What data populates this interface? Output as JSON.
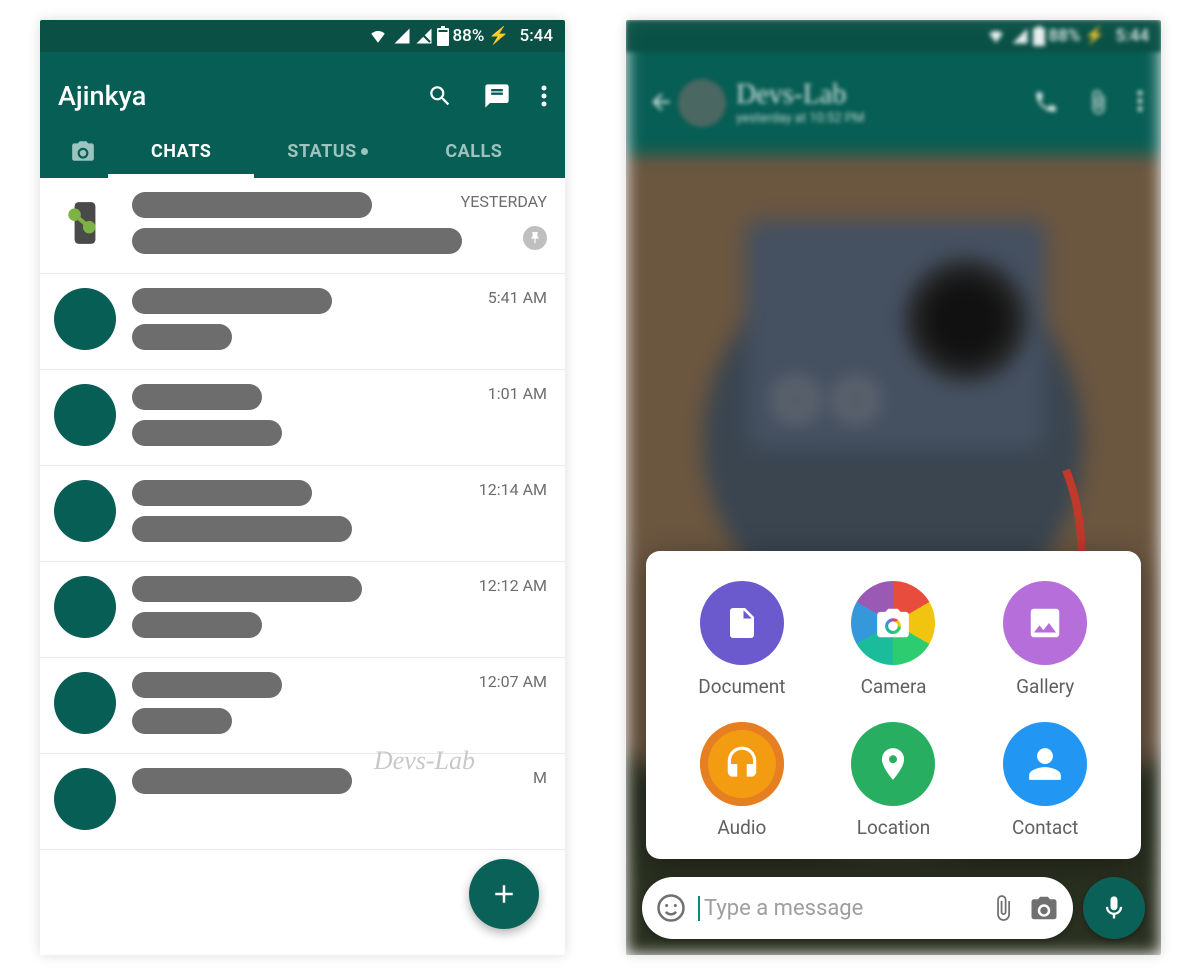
{
  "status": {
    "battery": "88%",
    "time": "5:44",
    "charging": "⚡"
  },
  "left": {
    "title": "Ajinkya",
    "tabs": {
      "chats": "CHATS",
      "status": "STATUS",
      "calls": "CALLS"
    },
    "chats": [
      {
        "time": "YESTERDAY",
        "pinned": true,
        "type": "group",
        "w1": 240,
        "w2": 330
      },
      {
        "time": "5:41 AM",
        "w1": 200,
        "w2": 100
      },
      {
        "time": "1:01 AM",
        "w1": 130,
        "w2": 150
      },
      {
        "time": "12:14 AM",
        "w1": 180,
        "w2": 220
      },
      {
        "time": "12:12 AM",
        "w1": 230,
        "w2": 130
      },
      {
        "time": "12:07 AM",
        "w1": 150,
        "w2": 100
      },
      {
        "time": "M",
        "w1": 220,
        "w2": 0
      }
    ],
    "watermark": "Devs-Lab"
  },
  "right": {
    "header": {
      "title": "Devs-Lab",
      "subtitle": "yesterday at 10:52 PM"
    },
    "attach": {
      "document": "Document",
      "camera": "Camera",
      "gallery": "Gallery",
      "audio": "Audio",
      "location": "Location",
      "contact": "Contact"
    },
    "input_placeholder": "Type a message"
  }
}
